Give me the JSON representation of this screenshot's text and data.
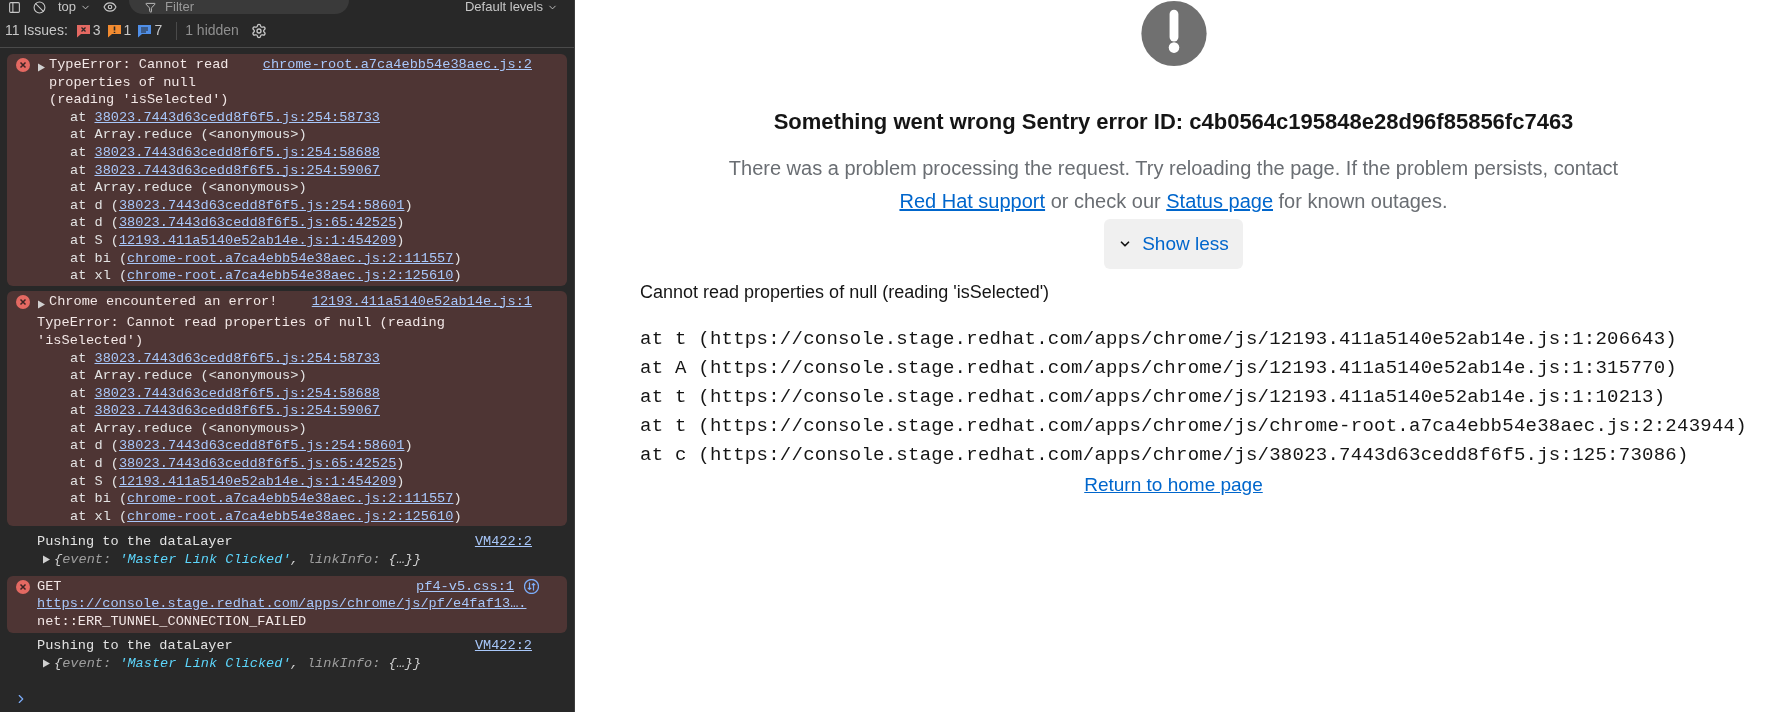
{
  "toolbar": {
    "context": "top",
    "filter": {
      "placeholder": "Filter"
    },
    "levels": "Default levels"
  },
  "issues": {
    "label": "11 Issues:",
    "counts": [
      {
        "kind": "error",
        "count": "3"
      },
      {
        "kind": "warning",
        "count": "1"
      },
      {
        "kind": "info",
        "count": "7"
      }
    ],
    "hidden": "1 hidden"
  },
  "messages": [
    {
      "kind": "error",
      "expanded": false,
      "text": "TypeError: Cannot read properties of null (reading 'isSelected')",
      "source": "chrome-root.a7ca4ebb54e38aec.js:2",
      "stack": [
        {
          "before": "at ",
          "link": "38023.7443d63cedd8f6f5.js:254:58733"
        },
        {
          "before": "at Array.reduce (<anonymous>)"
        },
        {
          "before": "at ",
          "link": "38023.7443d63cedd8f6f5.js:254:58688"
        },
        {
          "before": "at ",
          "link": "38023.7443d63cedd8f6f5.js:254:59067"
        },
        {
          "before": "at Array.reduce (<anonymous>)"
        },
        {
          "before": "at d (",
          "link": "38023.7443d63cedd8f6f5.js:254:58601",
          "after": ")"
        },
        {
          "before": "at d (",
          "link": "38023.7443d63cedd8f6f5.js:65:42525",
          "after": ")"
        },
        {
          "before": "at S (",
          "link": "12193.411a5140e52ab14e.js:1:454209",
          "after": ")"
        },
        {
          "before": "at bi (",
          "link": "chrome-root.a7ca4ebb54e38aec.js:2:111557",
          "after": ")"
        },
        {
          "before": "at xl (",
          "link": "chrome-root.a7ca4ebb54e38aec.js:2:125610",
          "after": ")"
        }
      ]
    },
    {
      "kind": "error",
      "expanded": false,
      "text": "Chrome encountered an error!",
      "source": "12193.411a5140e52ab14e.js:1",
      "detail": "TypeError: Cannot read properties of null (reading 'isSelected')",
      "stack": [
        {
          "before": "at ",
          "link": "38023.7443d63cedd8f6f5.js:254:58733"
        },
        {
          "before": "at Array.reduce (<anonymous>)"
        },
        {
          "before": "at ",
          "link": "38023.7443d63cedd8f6f5.js:254:58688"
        },
        {
          "before": "at ",
          "link": "38023.7443d63cedd8f6f5.js:254:59067"
        },
        {
          "before": "at Array.reduce (<anonymous>)"
        },
        {
          "before": "at d (",
          "link": "38023.7443d63cedd8f6f5.js:254:58601",
          "after": ")"
        },
        {
          "before": "at d (",
          "link": "38023.7443d63cedd8f6f5.js:65:42525",
          "after": ")"
        },
        {
          "before": "at S (",
          "link": "12193.411a5140e52ab14e.js:1:454209",
          "after": ")"
        },
        {
          "before": "at bi (",
          "link": "chrome-root.a7ca4ebb54e38aec.js:2:111557",
          "after": ")"
        },
        {
          "before": "at xl (",
          "link": "chrome-root.a7ca4ebb54e38aec.js:2:125610",
          "after": ")"
        }
      ]
    },
    {
      "kind": "log",
      "text": "Pushing to the dataLayer",
      "source": "VM422:2",
      "object": [
        {
          "kind": "punct",
          "text": "{"
        },
        {
          "kind": "key",
          "text": "event: "
        },
        {
          "kind": "string",
          "text": "'Master Link Clicked'"
        },
        {
          "kind": "punct",
          "text": ", "
        },
        {
          "kind": "key",
          "text": "linkInfo: "
        },
        {
          "kind": "punct",
          "text": "{…}}"
        }
      ]
    },
    {
      "kind": "network",
      "text": "GET",
      "source": "pf4-v5.css:1",
      "url": "https://console.stage.redhat.com/apps/chrome/js/pf/e4faf13….",
      "detail": "net::ERR_TUNNEL_CONNECTION_FAILED"
    },
    {
      "kind": "log",
      "text": "Pushing to the dataLayer",
      "source": "VM422:2",
      "object": [
        {
          "kind": "punct",
          "text": "{"
        },
        {
          "kind": "key",
          "text": "event: "
        },
        {
          "kind": "string",
          "text": "'Master Link Clicked'"
        },
        {
          "kind": "punct",
          "text": ", "
        },
        {
          "kind": "key",
          "text": "linkInfo: "
        },
        {
          "kind": "punct",
          "text": "{…}}"
        }
      ]
    }
  ],
  "page": {
    "title": "Something went wrong Sentry error ID: c4b0564c195848e28d96f85856fc7463",
    "description": [
      {
        "kind": "text",
        "text": "There was a problem processing the request. Try reloading the page. If the problem persists, contact "
      },
      {
        "kind": "link",
        "text": "Red Hat support"
      },
      {
        "kind": "text",
        "text": " or check our "
      },
      {
        "kind": "link",
        "text": "Status page"
      },
      {
        "kind": "text",
        "text": " for known outages."
      }
    ],
    "toggle": {
      "label": "Show less",
      "expanded": true
    },
    "error_message": "Cannot read properties of null (reading 'isSelected')",
    "stack": [
      "at t (https://console.stage.redhat.com/apps/chrome/js/12193.411a5140e52ab14e.js:1:206643)",
      "at A (https://console.stage.redhat.com/apps/chrome/js/12193.411a5140e52ab14e.js:1:315770)",
      "at t (https://console.stage.redhat.com/apps/chrome/js/12193.411a5140e52ab14e.js:1:10213)",
      "at t (https://console.stage.redhat.com/apps/chrome/js/chrome-root.a7ca4ebb54e38aec.js:2:243944)",
      "at c (https://console.stage.redhat.com/apps/chrome/js/38023.7443d63cedd8f6f5.js:125:73086)"
    ],
    "home_link": "Return to home page"
  }
}
